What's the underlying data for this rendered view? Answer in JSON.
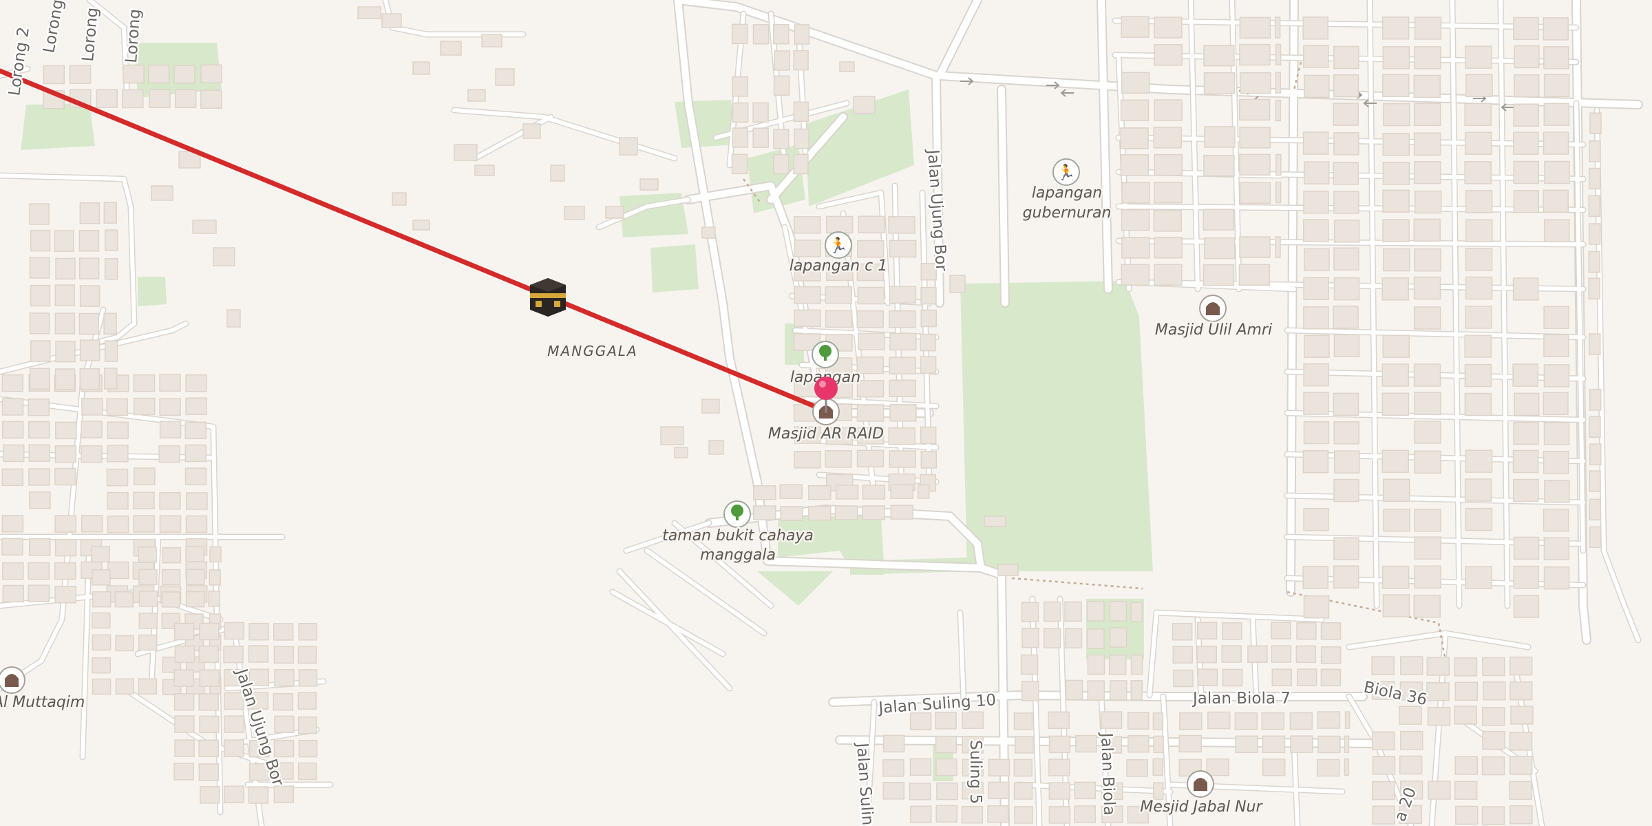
{
  "map": {
    "area_label": "MANGGALA",
    "qibla_line_color": "#d42a2a",
    "marker_color": "#e8356a",
    "background": "#f7f4f0",
    "park_color": "#d8e9cb"
  },
  "pois": [
    {
      "id": "lapangan-gubernuran",
      "lines": [
        "lapangan",
        "gubernuran"
      ],
      "icon": "sports-field-icon"
    },
    {
      "id": "lapangan-c1",
      "lines": [
        "lapangan c 1"
      ],
      "icon": "sports-field-icon"
    },
    {
      "id": "masjid-ulil-amri",
      "lines": [
        "Masjid Ulil Amri"
      ],
      "icon": "mosque-icon"
    },
    {
      "id": "lapangan",
      "lines": [
        "lapangan"
      ],
      "icon": "tree-icon"
    },
    {
      "id": "masjid-ar-raid",
      "lines": [
        "Masjid AR RAID"
      ],
      "icon": "mosque-icon"
    },
    {
      "id": "taman-bukit",
      "lines": [
        "taman bukit cahaya",
        "manggala"
      ],
      "icon": "tree-icon"
    },
    {
      "id": "al-muttaqim",
      "lines": [
        "Al Muttaqim"
      ],
      "icon": "mosque-icon"
    },
    {
      "id": "masjid-jabal-nur",
      "lines": [
        "Mesjid Jabal Nur"
      ],
      "icon": "mosque-icon"
    }
  ],
  "streets": [
    {
      "id": "lorong-2",
      "text": "Lorong 2"
    },
    {
      "id": "lorong-a",
      "text": "Lorong"
    },
    {
      "id": "lorong-b",
      "text": "Lorong"
    },
    {
      "id": "jalan-ujung-bor-north",
      "text": "Jalan Ujung Bor"
    },
    {
      "id": "jalan-ujung-bor-south",
      "text": "Jalan Ujung Bor"
    },
    {
      "id": "jalan-suling-10",
      "text": "Jalan Suling 10"
    },
    {
      "id": "jalan-biola-7",
      "text": "Jalan Biola 7"
    },
    {
      "id": "biola-36",
      "text": "Biola 36"
    },
    {
      "id": "jalan-suling",
      "text": "Jalan Suling"
    },
    {
      "id": "suling-5",
      "text": "Suling 5"
    },
    {
      "id": "jalan-biola",
      "text": "Jalan Biola"
    },
    {
      "id": "biola-20",
      "text": "a 20"
    }
  ]
}
